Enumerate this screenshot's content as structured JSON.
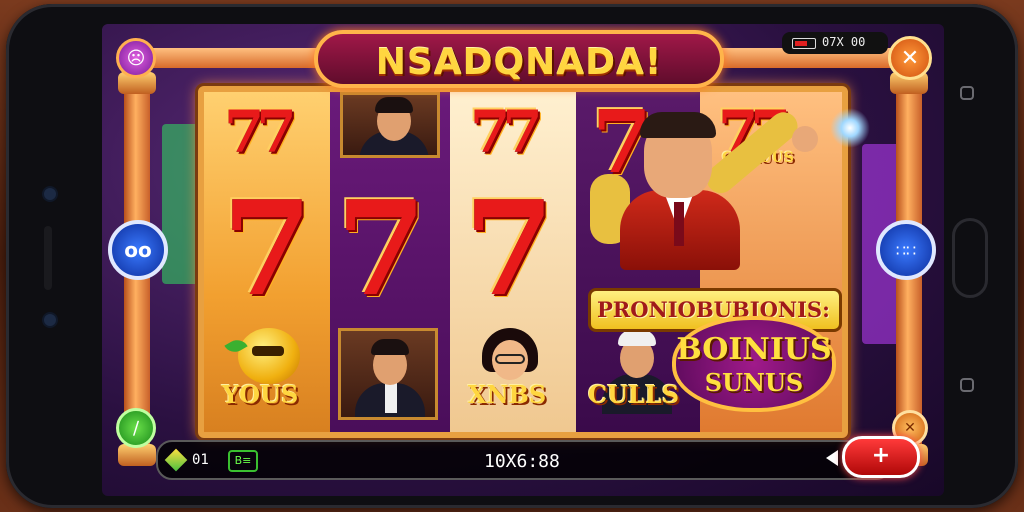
{
  "game": {
    "title": "NSADQNADA!",
    "status_time": "07X 00"
  },
  "buttons": {
    "menu_icon": "☹",
    "close_icon": "✕",
    "left_side_label": "oo",
    "right_side_label": "∷∷",
    "green_icon": "∕",
    "orange_icon": "✕",
    "spin_icon": "+"
  },
  "reels": {
    "seven_small": "77",
    "seven_big": "7",
    "reel5_seven": "77",
    "reel5_label": "CO LUUS",
    "symbol_labels": {
      "ball": "YOUS",
      "woman": "XNBS",
      "man": "CULLS"
    }
  },
  "bonus": {
    "banner_top": "PRONIOBUBJONIS:",
    "bubble_line1": "BOINIUS",
    "bubble_line2": "SUNUS"
  },
  "bottom_bar": {
    "label": "01",
    "chip": "B≡",
    "total": "10X6:88"
  },
  "colors": {
    "accent_gold": "#ffd640",
    "seven_red": "#e81a1a",
    "spin_red": "#ff3a3a",
    "frame_orange": "#e8a040"
  }
}
